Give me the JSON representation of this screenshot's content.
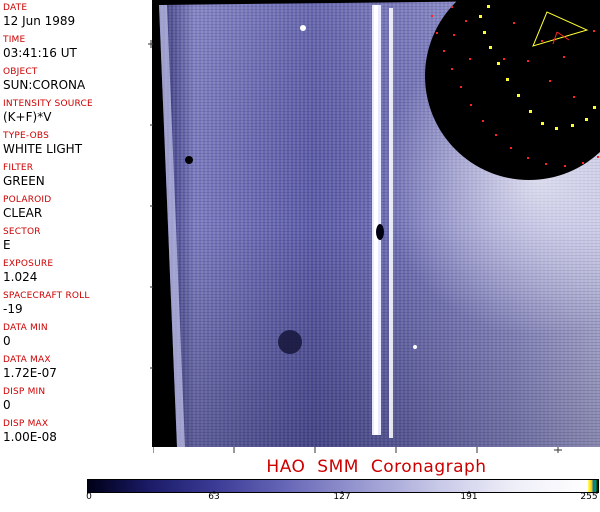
{
  "metadata": [
    {
      "label": "DATE",
      "value": "12 Jun 1989"
    },
    {
      "label": "TIME",
      "value": "03:41:16 UT"
    },
    {
      "label": "OBJECT",
      "value": "SUN:CORONA"
    },
    {
      "label": "INTENSITY SOURCE",
      "value": "(K+F)*V"
    },
    {
      "label": "TYPE-OBS",
      "value": "WHITE LIGHT"
    },
    {
      "label": "FILTER",
      "value": "GREEN"
    },
    {
      "label": "POLAROID",
      "value": "CLEAR"
    },
    {
      "label": "SECTOR",
      "value": "E"
    },
    {
      "label": "EXPOSURE",
      "value": "1.024"
    },
    {
      "label": "SPACECRAFT ROLL",
      "value": "-19"
    },
    {
      "label": "DATA MIN",
      "value": "0"
    },
    {
      "label": "DATA MAX",
      "value": "1.72E-07"
    },
    {
      "label": "DISP MIN",
      "value": "0"
    },
    {
      "label": "DISP MAX",
      "value": "1.00E-08"
    }
  ],
  "title": "HAO  SMM Coronagraph",
  "colorbar": {
    "ticks": [
      "0",
      "63",
      "127",
      "191",
      "255"
    ],
    "tick_values": [
      0,
      63,
      127,
      191,
      255
    ],
    "range": [
      0,
      255
    ]
  },
  "colors": {
    "label": "#cc0000",
    "title": "#cc0000",
    "image_tint": "#5555aa",
    "overlay_yellow": "#ffff33",
    "overlay_red": "#ff2222"
  }
}
